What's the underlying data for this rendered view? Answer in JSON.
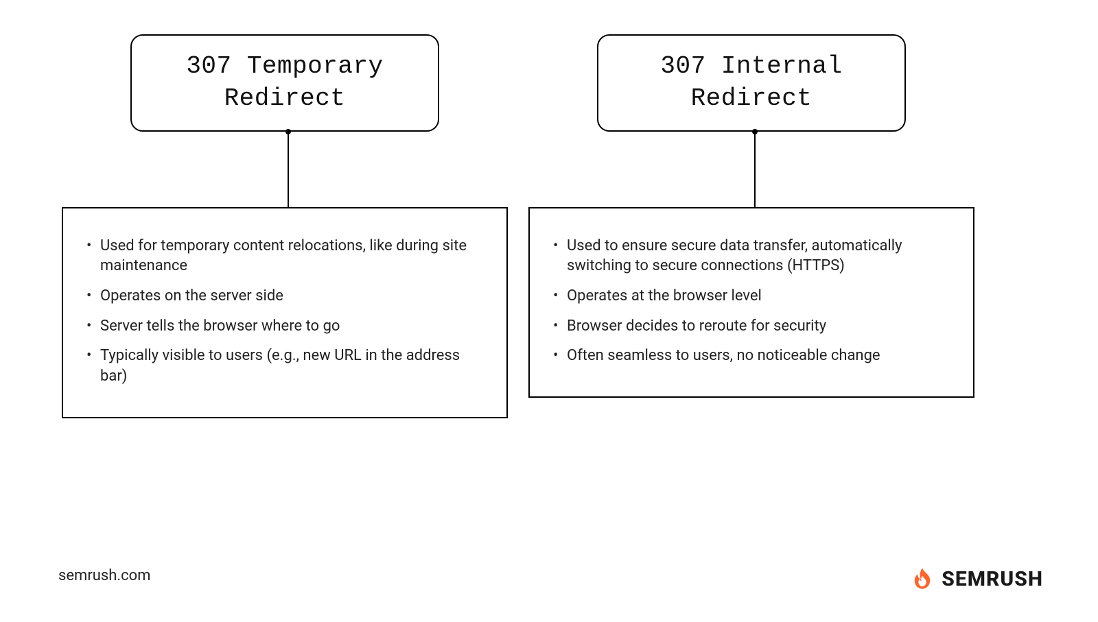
{
  "columns": [
    {
      "accent": "purple",
      "title": "307 Temporary Redirect",
      "bullets": [
        "Used for temporary content relocations, like during site maintenance",
        "Operates on the server side",
        "Server tells the browser where to go",
        "Typically visible to users (e.g., new URL in the address bar)"
      ]
    },
    {
      "accent": "blue",
      "title": "307 Internal Redirect",
      "bullets": [
        "Used to ensure secure data transfer, automatically switching to secure connections (HTTPS)",
        "Operates at the browser level",
        "Browser decides to reroute for security",
        "Often seamless to users, no noticeable change"
      ]
    }
  ],
  "footer": {
    "domain": "semrush.com"
  },
  "brand": {
    "name": "SEMRUSH"
  },
  "colors": {
    "purple": "#d9caf0",
    "blue": "#c6e6fb"
  }
}
